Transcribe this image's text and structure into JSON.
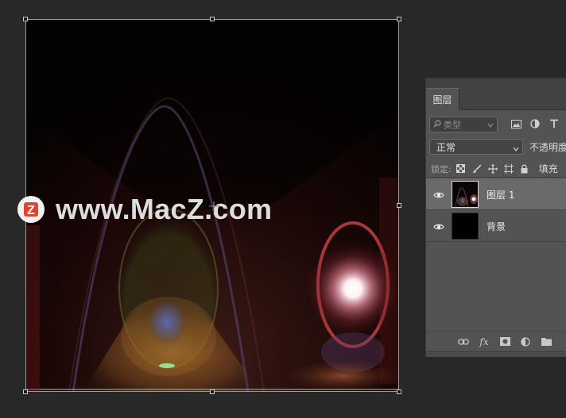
{
  "canvas": {
    "watermark_text": "www.MacZ.com",
    "watermark_logo_letter": "Z",
    "cursor_icon": "move-crosshair-icon"
  },
  "layers_panel": {
    "tab_label": "图层",
    "filter": {
      "icon": "search-icon",
      "placeholder": "类型",
      "filter_icons": [
        "image-filter-icon",
        "adjustment-filter-icon",
        "text-filter-icon"
      ]
    },
    "blend_mode": "正常",
    "opacity_label": "不透明度",
    "lock": {
      "label": "锁定:",
      "icons": [
        "lock-transparent-icon",
        "lock-brush-icon",
        "lock-position-icon",
        "lock-artboard-icon",
        "lock-all-icon"
      ]
    },
    "fill_label": "填充",
    "layers": [
      {
        "name": "图层 1",
        "visible": true,
        "selected": true
      },
      {
        "name": "背景",
        "visible": true,
        "selected": false
      }
    ],
    "footer_icons": [
      "link-layers-icon",
      "fx-icon",
      "add-mask-icon",
      "adjustment-layer-icon",
      "new-group-icon"
    ],
    "footer_fx_text": "fx"
  },
  "colors": {
    "workspace_bg": "#282828",
    "panel_bg": "#535353",
    "selected_layer_bg": "#6a6a6a",
    "watermark_logo_red": "#e0442e"
  }
}
